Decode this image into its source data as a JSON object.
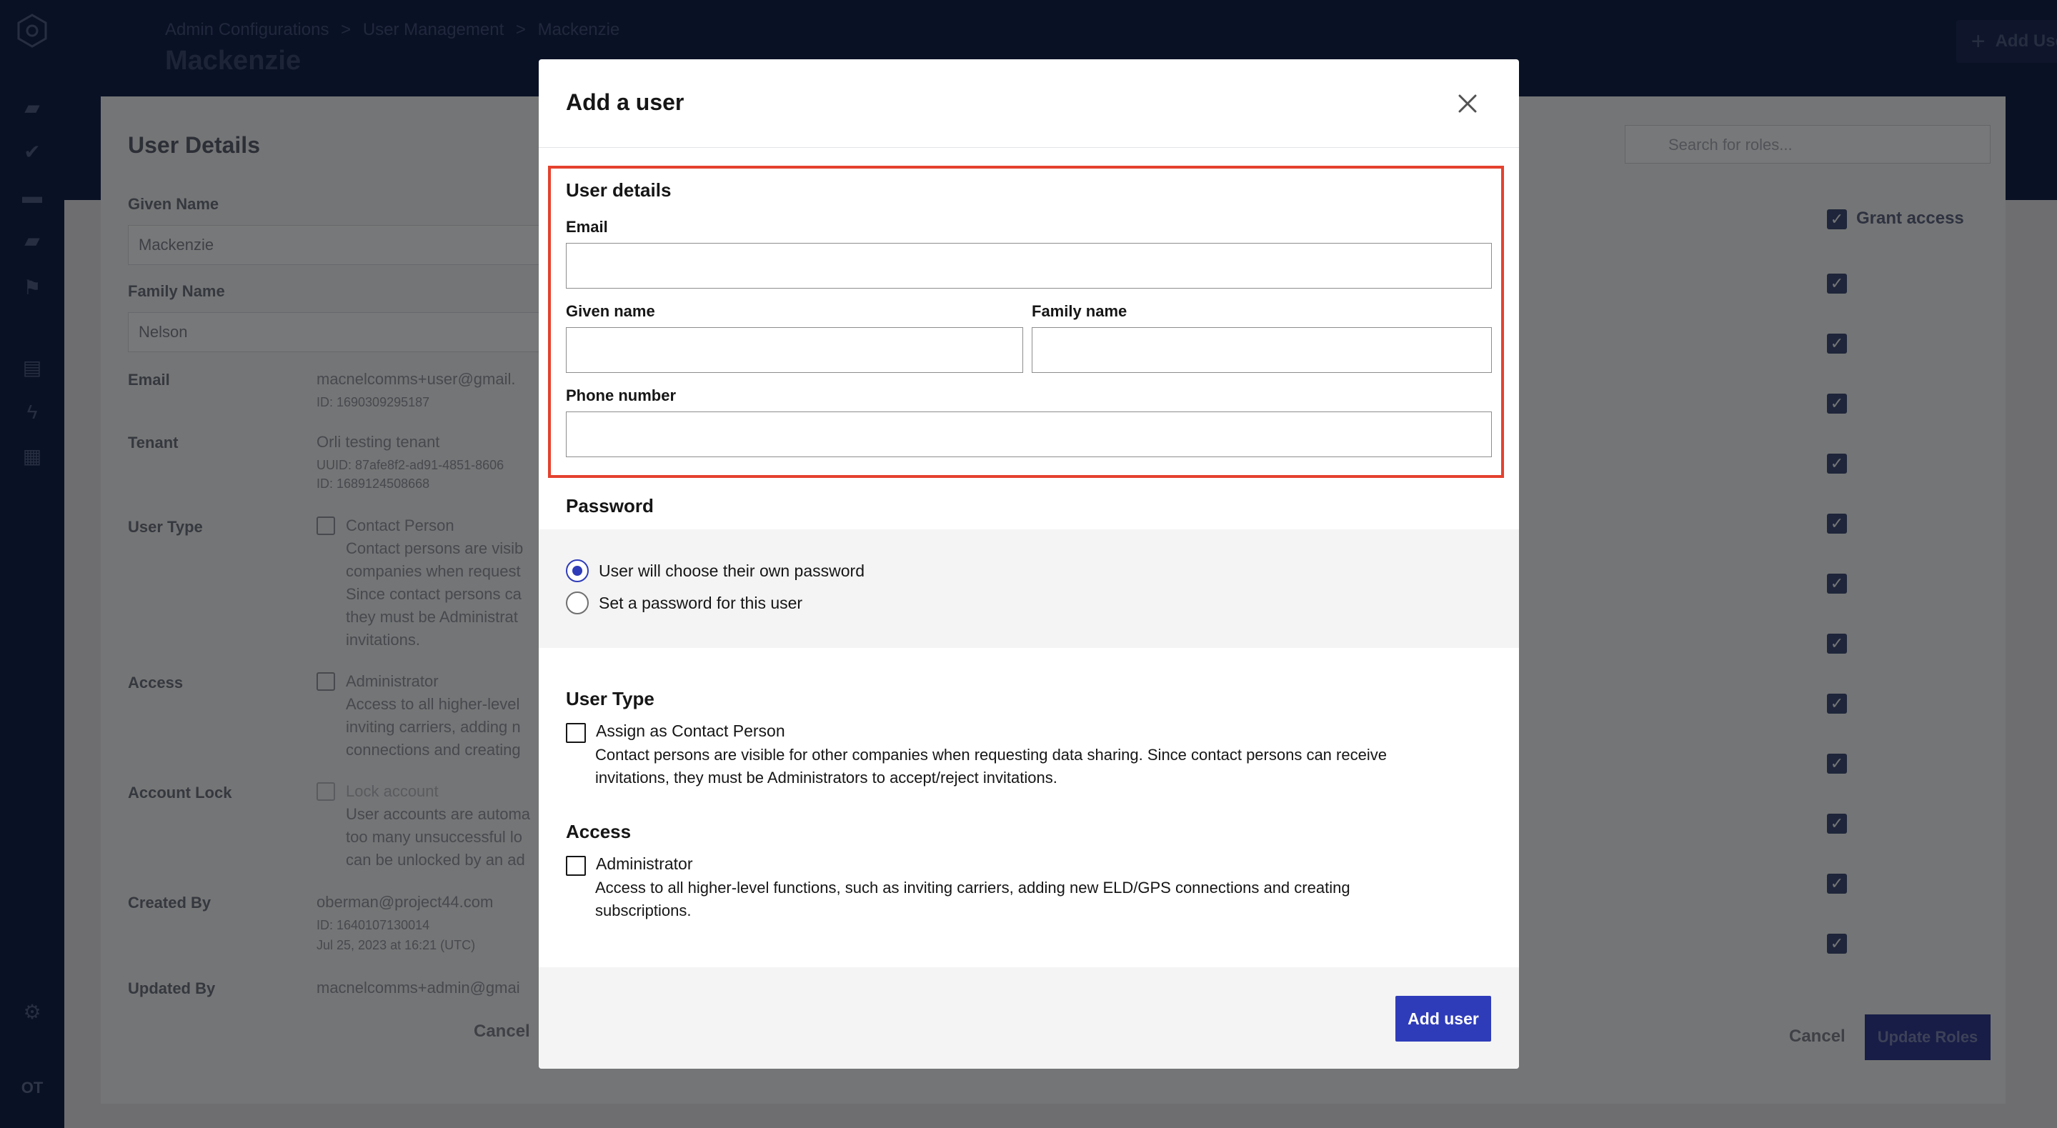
{
  "background": {
    "breadcrumb": [
      "Admin Configurations",
      ">",
      "User Management",
      ">",
      "Mackenzie"
    ],
    "page_title": "Mackenzie",
    "add_user_button": "Add User",
    "user_details_title": "User Details",
    "given_name_label": "Given Name",
    "given_name_value": "Mackenzie",
    "family_name_label": "Family Name",
    "family_name_value": "Nelson",
    "email_label": "Email",
    "email_value": "macnelcomms+user@gmail.",
    "email_id": "ID: 1690309295187",
    "tenant_label": "Tenant",
    "tenant_value": "Orli testing tenant",
    "tenant_uuid": "UUID: 87afe8f2-ad91-4851-8606",
    "tenant_id": "ID: 1689124508668",
    "user_type_label": "User Type",
    "user_type_option": "Contact Person",
    "user_type_desc": [
      "Contact persons are visib",
      "companies when request",
      "Since contact persons ca",
      "they must be Administrat",
      "invitations."
    ],
    "access_label": "Access",
    "access_option": "Administrator",
    "access_desc": [
      "Access to all higher-level",
      "inviting carriers, adding n",
      "connections and creating"
    ],
    "account_lock_label": "Account Lock",
    "account_lock_option": "Lock account",
    "account_lock_desc": [
      "User accounts are automa",
      "too many unsuccessful lo",
      "can be unlocked by an ad"
    ],
    "created_by_label": "Created By",
    "created_by_value": "oberman@project44.com",
    "created_by_id": "ID: 1640107130014",
    "created_by_date": "Jul 25, 2023 at 16:21 (UTC)",
    "updated_by_label": "Updated By",
    "updated_by_value": "macnelcomms+admin@gmai",
    "cancel_left": "Cancel",
    "search_placeholder": "Search for roles...",
    "grant_access": "Grant access",
    "cancel_right": "Cancel",
    "update_roles": "Update Roles",
    "sidebar_footer": "OT"
  },
  "modal": {
    "title": "Add a user",
    "user_details": {
      "title": "User details",
      "email_label": "Email",
      "email_value": "",
      "given_name_label": "Given name",
      "given_name_value": "",
      "family_name_label": "Family name",
      "family_name_value": "",
      "phone_label": "Phone number",
      "phone_value": ""
    },
    "password": {
      "title": "Password",
      "options": [
        {
          "label": "User will choose their own password",
          "selected": true
        },
        {
          "label": "Set a password for this user",
          "selected": false
        }
      ]
    },
    "user_type": {
      "title": "User Type",
      "option": "Assign as Contact Person",
      "checked": false,
      "desc_lines": [
        "Contact persons are visible for other companies when requesting data sharing. Since contact persons can receive",
        "invitations, they must be Administrators to accept/reject invitations."
      ]
    },
    "access": {
      "title": "Access",
      "option": "Administrator",
      "checked": false,
      "desc_lines": [
        "Access to all higher-level functions, such as inviting carriers, adding new ELD/GPS connections and creating",
        "subscriptions."
      ]
    },
    "submit_label": "Add user"
  },
  "colors": {
    "primary": "#2f3cb9",
    "highlight": "#e4412e",
    "nav": "#13234a"
  }
}
